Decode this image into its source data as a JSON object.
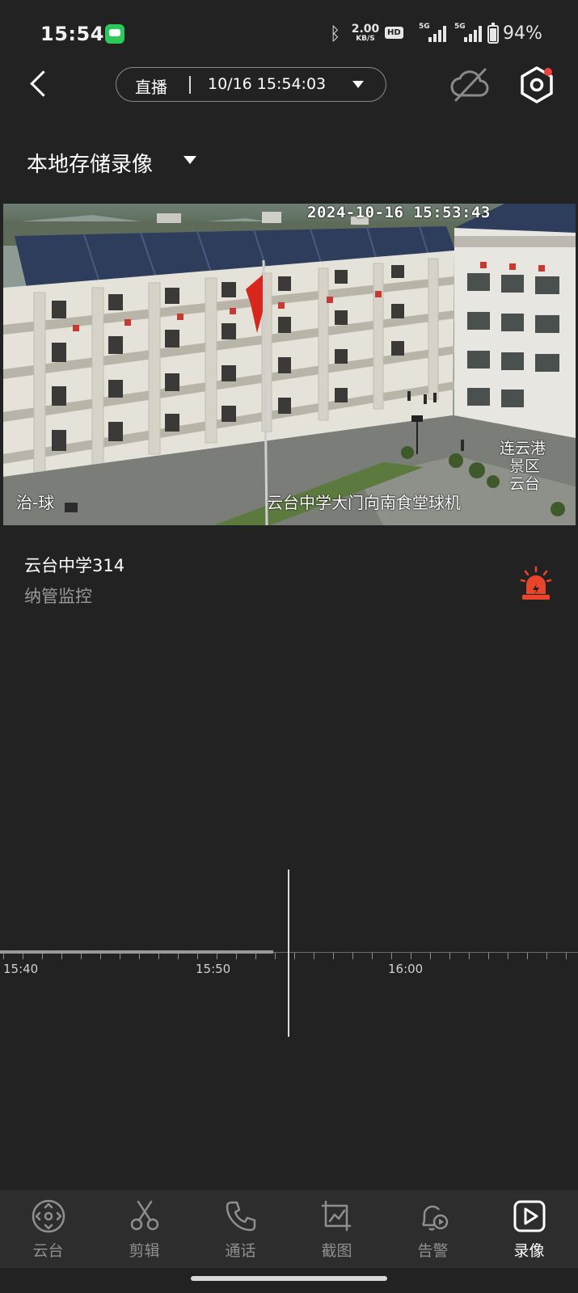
{
  "status_bar": {
    "time": "15:54",
    "net_speed_value": "2.00",
    "net_speed_unit": "KB/S",
    "hd_badge": "HD",
    "signal_1_label": "5G",
    "signal_2_label": "5G",
    "battery_level": 0.94,
    "battery_text": "94%",
    "icons": [
      "message-app-icon",
      "bluetooth-icon",
      "signal-icon",
      "battery-icon"
    ]
  },
  "header": {
    "mode": "直播",
    "datetime": "10/16 15:54:03",
    "icons": [
      "back-icon",
      "cloud-off-icon",
      "settings-icon"
    ]
  },
  "storage": {
    "label": "本地存储录像"
  },
  "video": {
    "timestamp": "2024-10-16 15:53:43",
    "overlay_left": "治-球",
    "overlay_camera": "云台中学大门向南食堂球机",
    "overlay_right_1": "连云港",
    "overlay_right_2": "景区",
    "overlay_right_3": "云台"
  },
  "device": {
    "name": "云台中学314",
    "subtitle": "纳管监控",
    "alarm_icon": "alarm-light-icon",
    "alarm_color": "#e8452b"
  },
  "timeline": {
    "labels": [
      "15:40",
      "15:50",
      "16:00"
    ],
    "recorded_until": "15:53"
  },
  "bottom_nav": {
    "items": [
      {
        "label": "云台",
        "icon": "ptz-icon"
      },
      {
        "label": "剪辑",
        "icon": "scissors-icon"
      },
      {
        "label": "通话",
        "icon": "phone-icon"
      },
      {
        "label": "截图",
        "icon": "screenshot-icon"
      },
      {
        "label": "告警",
        "icon": "alert-bell-icon"
      },
      {
        "label": "录像",
        "icon": "video-record-icon"
      }
    ],
    "active_index": 5
  }
}
